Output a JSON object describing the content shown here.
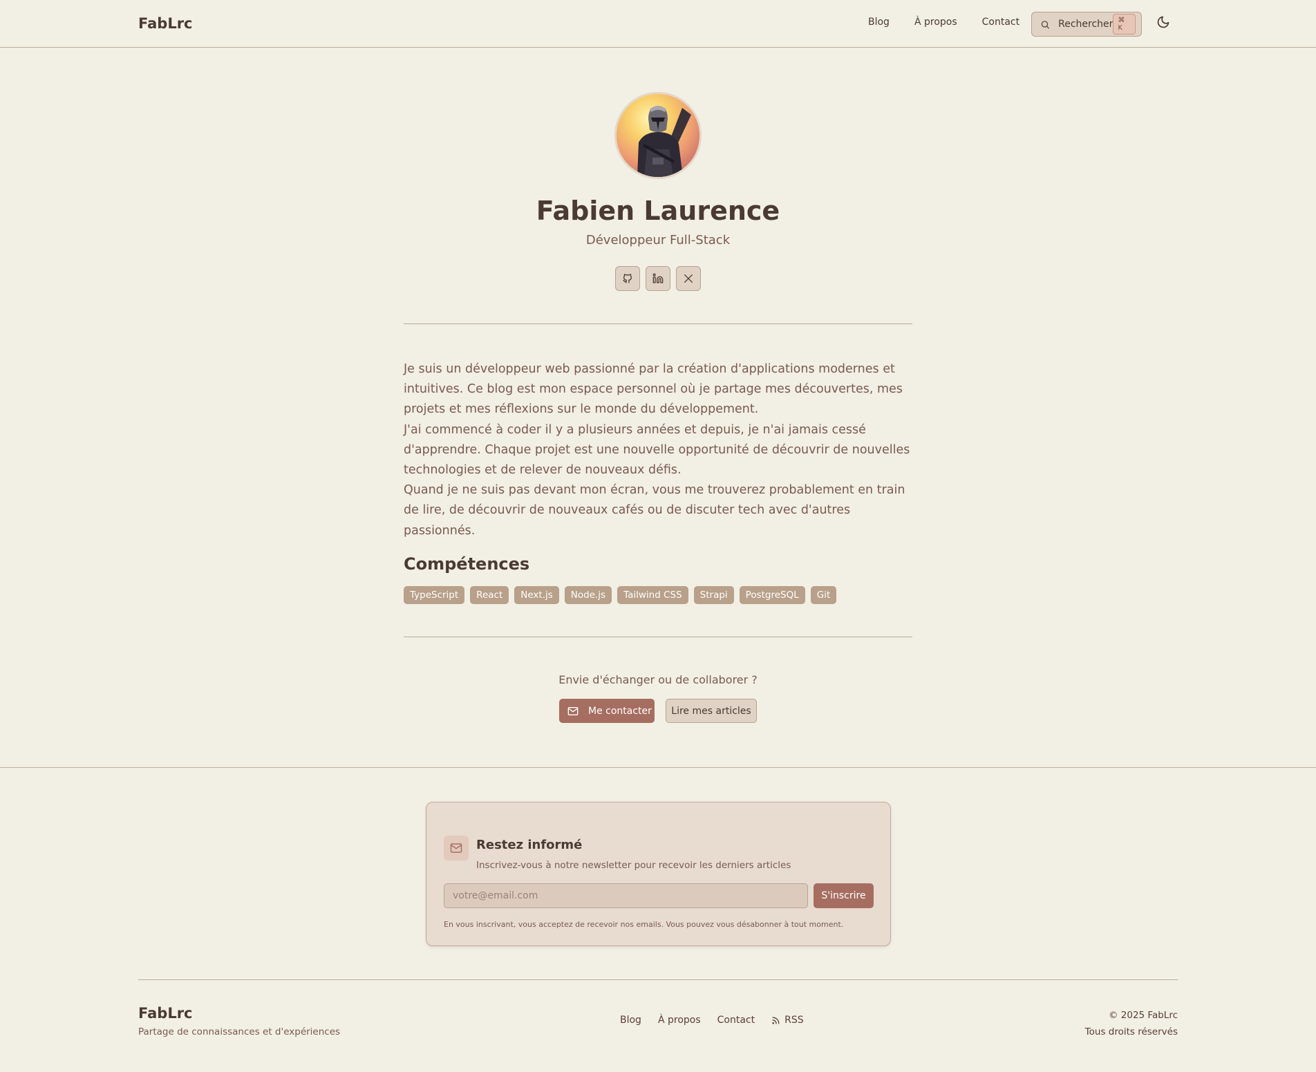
{
  "header": {
    "brand": "FabLrc",
    "nav": [
      "Blog",
      "À propos",
      "Contact"
    ],
    "search_label": "Rechercher",
    "search_shortcut": "⌘ K"
  },
  "profile": {
    "name": "Fabien Laurence",
    "role": "Développeur Full-Stack",
    "socials": [
      "github-icon",
      "linkedin-icon",
      "x-icon"
    ]
  },
  "bio": [
    "Je suis un développeur web passionné par la création d'applications modernes et intuitives. Ce blog est mon espace personnel où je partage mes découvertes, mes projets et mes réflexions sur le monde du développement.",
    "J'ai commencé à coder il y a plusieurs années et depuis, je n'ai jamais cessé d'apprendre. Chaque projet est une nouvelle opportunité de découvrir de nouvelles technologies et de relever de nouveaux défis.",
    "Quand je ne suis pas devant mon écran, vous me trouverez probablement en train de lire, de découvrir de nouveaux cafés ou de discuter tech avec d'autres passionnés."
  ],
  "skills": {
    "title": "Compétences",
    "items": [
      "TypeScript",
      "React",
      "Next.js",
      "Node.js",
      "Tailwind CSS",
      "Strapi",
      "PostgreSQL",
      "Git"
    ]
  },
  "cta": {
    "text": "Envie d'échanger ou de collaborer ?",
    "primary_label": "Me contacter",
    "secondary_label": "Lire mes articles"
  },
  "newsletter": {
    "title": "Restez informé",
    "subtitle": "Inscrivez-vous à notre newsletter pour recevoir les derniers articles",
    "placeholder": "votre@email.com",
    "submit_label": "S'inscrire",
    "note": "En vous inscrivant, vous acceptez de recevoir nos emails. Vous pouvez vous désabonner à tout moment."
  },
  "footer": {
    "brand": "FabLrc",
    "tagline": "Partage de connaissances et d'expériences",
    "nav": [
      "Blog",
      "À propos",
      "Contact",
      "RSS"
    ],
    "copyright": "© 2025 FabLrc",
    "rights": "Tous droits réservés"
  },
  "colors": {
    "background": "#f2efe4",
    "accent": "#a66e60",
    "tag": "#b8a08a",
    "text": "#4a3a33"
  }
}
